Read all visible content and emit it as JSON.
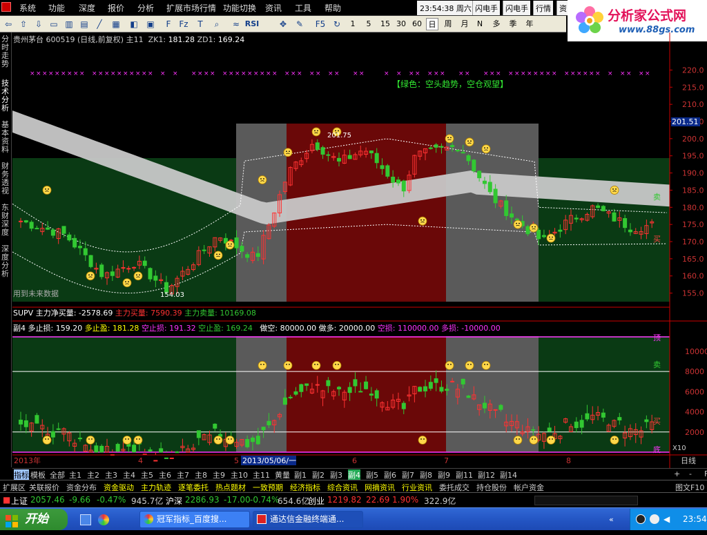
{
  "menu": [
    "系统",
    "功能",
    "深度",
    "报价",
    "分析",
    "扩展市场行情",
    "功能切换",
    "资讯",
    "工具",
    "帮助"
  ],
  "clock": "23:54:38 周六",
  "top_buttons": [
    "闪电手",
    "闪电手",
    "行情",
    "资"
  ],
  "brand": {
    "title": "分析家公式网",
    "url": "www.88gs.com"
  },
  "toolbar": {
    "periods": [
      "1",
      "5",
      "15",
      "30",
      "60"
    ],
    "period_cn": [
      "日",
      "周",
      "月",
      "N",
      "多",
      "季",
      "年"
    ],
    "rsi": "RSI"
  },
  "side_tabs": [
    "分时走势",
    "技术分析",
    "基本资料",
    "财务透视",
    "东财深度",
    "深度分析"
  ],
  "stock": {
    "name": "贵州茅台",
    "code": "600519",
    "mode": "(日线,前复权)",
    "indicator": "主11",
    "zk1_label": "ZK1:",
    "zk1": "181.28",
    "zd1_label": "ZD1:",
    "zd1": "169.24"
  },
  "main_chart": {
    "annotations": {
      "green_note": "【绿色：空头趋势，空仓观望】",
      "high_label": "201.75",
      "low_label": "154.03",
      "future_note": "用到未来数据",
      "buy": "买",
      "sell": "卖"
    },
    "current_price": "201.51",
    "y_ticks": [
      "220.0",
      "215.0",
      "210.0",
      "205.0",
      "200.0",
      "195.0",
      "190.0",
      "185.0",
      "180.0",
      "175.0",
      "170.0",
      "165.0",
      "160.0",
      "155.0"
    ]
  },
  "sub_line": {
    "name": "SUPV",
    "l1": "主力净买量:",
    "v1": "-2578.69",
    "l2": "主力买量:",
    "v2": "7590.39",
    "l3": "主力卖量:",
    "v3": "10169.08"
  },
  "sub4_line": {
    "name": "副4",
    "a": "多止损:",
    "av": "159.20",
    "b": "多止盈:",
    "bv": "181.28",
    "c": "空止损:",
    "cv": "191.32",
    "d": "空止盈:",
    "dv": "169.24",
    "e": "做空:",
    "ev": "80000.00",
    "f": "做多:",
    "fv": "20000.00",
    "g": "空损:",
    "gv": "110000.00",
    "h": "多损:",
    "hv": "-10000.00"
  },
  "sub_chart": {
    "y_ticks": [
      "10000",
      "8000",
      "6000",
      "4000",
      "2000"
    ],
    "top_label": "顶",
    "bottom_label": "底",
    "sell": "卖",
    "buy": "买",
    "zoom": "X10"
  },
  "dates": {
    "year": "2013年",
    "m4": "4",
    "m5": "5",
    "cursor": "2013/05/06/一",
    "m6": "6",
    "m7": "7",
    "m8": "8",
    "period": "日线"
  },
  "bottom_tabs": [
    "指标",
    "模板",
    "全部",
    "主1",
    "主2",
    "主3",
    "主4",
    "主5",
    "主6",
    "主7",
    "主8",
    "主9",
    "主10",
    "主11",
    "黄量",
    "副1",
    "副2",
    "副3",
    "副4",
    "副5",
    "副6",
    "副7",
    "副8",
    "副9",
    "副11",
    "副12",
    "副14"
  ],
  "bottom_controls": [
    "+",
    "-",
    "F"
  ],
  "bottom_bar2": [
    "扩展区",
    "关联报价",
    "资金分布",
    "资金驱动",
    "主力轨迹",
    "逐笔委托",
    "热点题材",
    "一致预期",
    "经济指标",
    "综合资讯",
    "网摘资讯",
    "行业资讯",
    "委托成交",
    "持仓股份",
    "帐户资金",
    "图文F10"
  ],
  "index_bar": {
    "sh_label": "上证",
    "sh": "2057.46",
    "sh_chg": "-9.66",
    "sh_pct": "-0.47%",
    "sh_amt": "945.7亿",
    "sz_label": "沪深",
    "sz": "2286.93",
    "sz_chg": "-17.00",
    "sz_pct": "-0.74%",
    "sz_amt": "654.6亿",
    "cy_label": "创业",
    "cy": "1219.82",
    "cy_chg": "22.69",
    "cy_pct": "1.90%",
    "cy_amt": "322.9亿"
  },
  "taskbar": {
    "start": "开始",
    "task1": "冠军指标_百度搜...",
    "task2": "通达信金融终端通...",
    "time": "23:54"
  },
  "colors": {
    "bull": "#ff3232",
    "bear": "#32c832",
    "green_zone": "#0a3a14",
    "red_zone": "#6a0808",
    "gray_zone": "#5a5a5a",
    "band": "#c8c8c8",
    "magenta": "#ff33ff",
    "yellow": "#ffff00",
    "pricebox": "#0a2a8a"
  }
}
